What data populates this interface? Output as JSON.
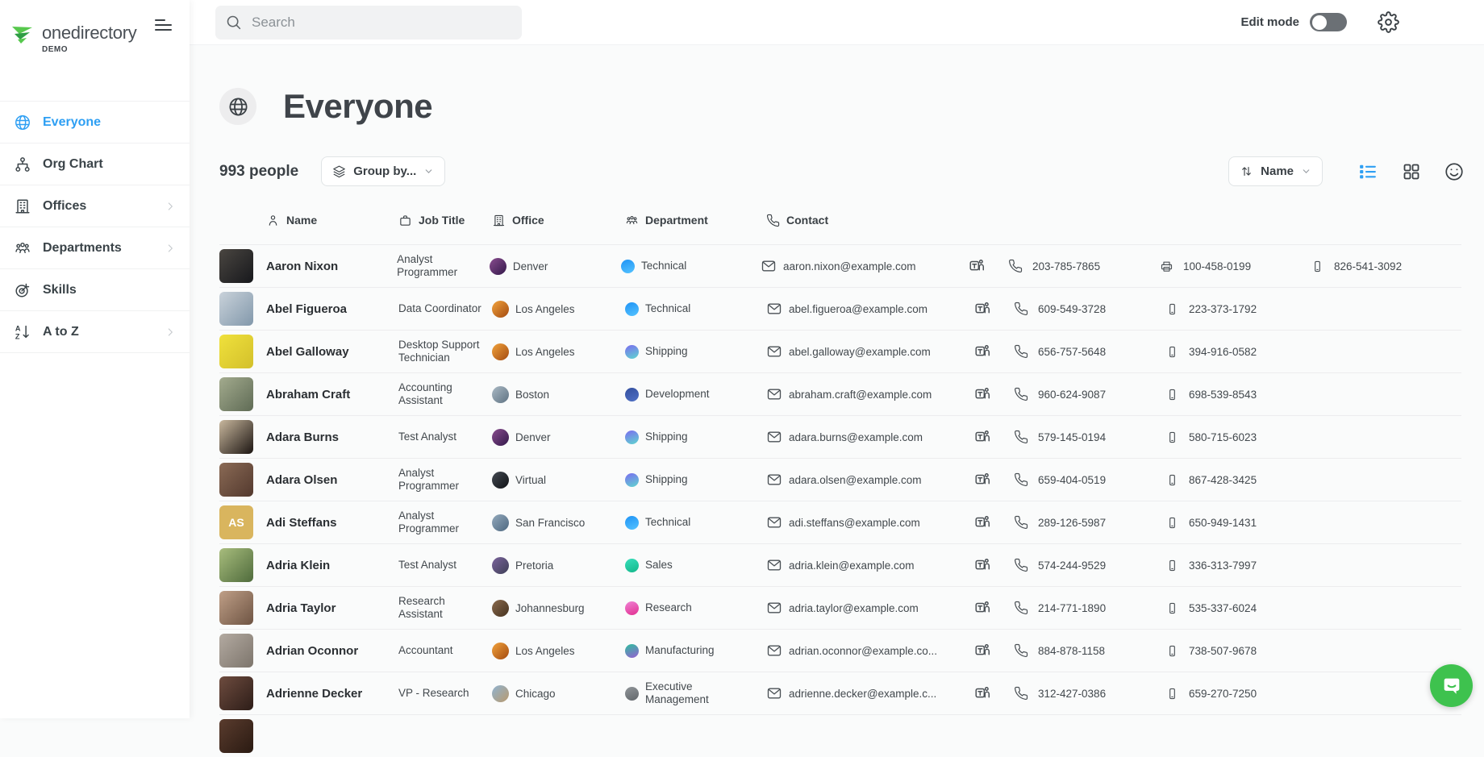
{
  "brand": {
    "name": "onedirectory",
    "badge": "DEMO"
  },
  "topbar": {
    "search_placeholder": "Search",
    "edit_mode_label": "Edit mode"
  },
  "sidebar": {
    "items": [
      {
        "label": "Everyone",
        "icon": "globe",
        "active": true,
        "chevron": false
      },
      {
        "label": "Org Chart",
        "icon": "orgchart",
        "active": false,
        "chevron": false
      },
      {
        "label": "Offices",
        "icon": "building",
        "active": false,
        "chevron": true
      },
      {
        "label": "Departments",
        "icon": "people",
        "active": false,
        "chevron": true
      },
      {
        "label": "Skills",
        "icon": "target",
        "active": false,
        "chevron": false
      },
      {
        "label": "A to Z",
        "icon": "az",
        "active": false,
        "chevron": true
      }
    ]
  },
  "page": {
    "title": "Everyone",
    "count": "993 people",
    "group_by_label": "Group by...",
    "sort_label": "Name"
  },
  "colors": {
    "accent": "#2e9ff3",
    "chat_button": "#3ec24e",
    "toggle_track": "#6b7075"
  },
  "table": {
    "columns": [
      {
        "key": "name",
        "label": "Name",
        "icon": "person"
      },
      {
        "key": "job",
        "label": "Job Title",
        "icon": "briefcase"
      },
      {
        "key": "office",
        "label": "Office",
        "icon": "building"
      },
      {
        "key": "dept",
        "label": "Department",
        "icon": "people"
      },
      {
        "key": "contact",
        "label": "Contact",
        "icon": "phone"
      }
    ],
    "rows": [
      {
        "name": "Aaron Nixon",
        "job": "Analyst Programmer",
        "avatar": {
          "from": "#4a4641",
          "to": "#17181c"
        },
        "office": {
          "label": "Denver",
          "from": "#8a4d8f",
          "to": "#33184a"
        },
        "dept": {
          "label": "Technical",
          "from": "#1f93f5",
          "to": "#55c3ff"
        },
        "contact": {
          "email": "aaron.nixon@example.com",
          "phone": "203-785-7865",
          "extras": [
            {
              "icon": "fax",
              "number": "100-458-0199"
            },
            {
              "icon": "mobile",
              "number": "826-541-3092"
            }
          ]
        }
      },
      {
        "name": "Abel Figueroa",
        "job": "Data Coordinator",
        "avatar": {
          "from": "#c9d2da",
          "to": "#8298ab"
        },
        "office": {
          "label": "Los Angeles",
          "from": "#f2a33c",
          "to": "#a34a10"
        },
        "dept": {
          "label": "Technical",
          "from": "#1f93f5",
          "to": "#55c3ff"
        },
        "contact": {
          "email": "abel.figueroa@example.com",
          "phone": "609-549-3728",
          "extras": [
            {
              "icon": "mobile",
              "number": "223-373-1792"
            }
          ]
        }
      },
      {
        "name": "Abel Galloway",
        "job": "Desktop Support Technician",
        "avatar": {
          "from": "#f0e13c",
          "to": "#d3c02b"
        },
        "office": {
          "label": "Los Angeles",
          "from": "#f2a33c",
          "to": "#a34a10"
        },
        "dept": {
          "label": "Shipping",
          "from": "#7b6cf0",
          "to": "#5fd6cf"
        },
        "contact": {
          "email": "abel.galloway@example.com",
          "phone": "656-757-5648",
          "extras": [
            {
              "icon": "mobile",
              "number": "394-916-0582"
            }
          ]
        }
      },
      {
        "name": "Abraham Craft",
        "job": "Accounting Assistant",
        "avatar": {
          "from": "#a3ab8e",
          "to": "#5f6b55"
        },
        "office": {
          "label": "Boston",
          "from": "#aab9c4",
          "to": "#5f7383"
        },
        "dept": {
          "label": "Development",
          "from": "#34509f",
          "to": "#4f6fc4"
        },
        "contact": {
          "email": "abraham.craft@example.com",
          "phone": "960-624-9087",
          "extras": [
            {
              "icon": "mobile",
              "number": "698-539-8543"
            }
          ]
        }
      },
      {
        "name": "Adara Burns",
        "job": "Test Analyst",
        "avatar": {
          "from": "#c9b89e",
          "to": "#1c1512"
        },
        "office": {
          "label": "Denver",
          "from": "#8a4d8f",
          "to": "#33184a"
        },
        "dept": {
          "label": "Shipping",
          "from": "#7b6cf0",
          "to": "#5fd6cf"
        },
        "contact": {
          "email": "adara.burns@example.com",
          "phone": "579-145-0194",
          "extras": [
            {
              "icon": "mobile",
              "number": "580-715-6023"
            }
          ]
        }
      },
      {
        "name": "Adara Olsen",
        "job": "Analyst Programmer",
        "avatar": {
          "from": "#8a6a55",
          "to": "#53392e"
        },
        "office": {
          "label": "Virtual",
          "from": "#444a52",
          "to": "#101216"
        },
        "dept": {
          "label": "Shipping",
          "from": "#7b6cf0",
          "to": "#5fd6cf"
        },
        "contact": {
          "email": "adara.olsen@example.com",
          "phone": "659-404-0519",
          "extras": [
            {
              "icon": "mobile",
              "number": "867-428-3425"
            }
          ]
        }
      },
      {
        "name": "Adi Steffans",
        "job": "Analyst Programmer",
        "avatar": {
          "initials": "AS",
          "bg": "#d9b55e"
        },
        "office": {
          "label": "San Francisco",
          "from": "#93a9bc",
          "to": "#4e6880"
        },
        "dept": {
          "label": "Technical",
          "from": "#1f93f5",
          "to": "#55c3ff"
        },
        "contact": {
          "email": "adi.steffans@example.com",
          "phone": "289-126-5987",
          "extras": [
            {
              "icon": "mobile",
              "number": "650-949-1431"
            }
          ]
        }
      },
      {
        "name": "Adria Klein",
        "job": "Test Analyst",
        "avatar": {
          "from": "#a8bd7d",
          "to": "#4f6b3c"
        },
        "office": {
          "label": "Pretoria",
          "from": "#7a639c",
          "to": "#3e3f56"
        },
        "dept": {
          "label": "Sales",
          "from": "#38debb",
          "to": "#14b78a"
        },
        "contact": {
          "email": "adria.klein@example.com",
          "phone": "574-244-9529",
          "extras": [
            {
              "icon": "mobile",
              "number": "336-313-7997"
            }
          ]
        }
      },
      {
        "name": "Adria Taylor",
        "job": "Research Assistant",
        "avatar": {
          "from": "#bf9f87",
          "to": "#6e5443"
        },
        "office": {
          "label": "Johannesburg",
          "from": "#8a6a4d",
          "to": "#46321f"
        },
        "dept": {
          "label": "Research",
          "from": "#ef83d5",
          "to": "#e22f90"
        },
        "contact": {
          "email": "adria.taylor@example.com",
          "phone": "214-771-1890",
          "extras": [
            {
              "icon": "mobile",
              "number": "535-337-6024"
            }
          ]
        }
      },
      {
        "name": "Adrian Oconnor",
        "job": "Accountant",
        "avatar": {
          "from": "#b3aaa1",
          "to": "#7d756c"
        },
        "office": {
          "label": "Los Angeles",
          "from": "#f2a33c",
          "to": "#a34a10"
        },
        "dept": {
          "label": "Manufacturing",
          "from": "#2dbf9e",
          "to": "#975fd2"
        },
        "contact": {
          "email": "adrian.oconnor@example.co...",
          "phone": "884-878-1158",
          "extras": [
            {
              "icon": "mobile",
              "number": "738-507-9678"
            }
          ]
        }
      },
      {
        "name": "Adrienne Decker",
        "job": "VP - Research",
        "avatar": {
          "from": "#6e4c3f",
          "to": "#2d1d18"
        },
        "office": {
          "label": "Chicago",
          "from": "#8fb3d1",
          "to": "#b99a6e"
        },
        "dept": {
          "label": "Executive Management",
          "from": "#909599",
          "to": "#62676b"
        },
        "contact": {
          "email": "adrienne.decker@example.c...",
          "phone": "312-427-0386",
          "extras": [
            {
              "icon": "mobile",
              "number": "659-270-7250"
            }
          ]
        }
      },
      {
        "partial": true,
        "name": "",
        "avatar": {
          "from": "#5a3c2e",
          "to": "#2a1a12"
        }
      }
    ]
  }
}
